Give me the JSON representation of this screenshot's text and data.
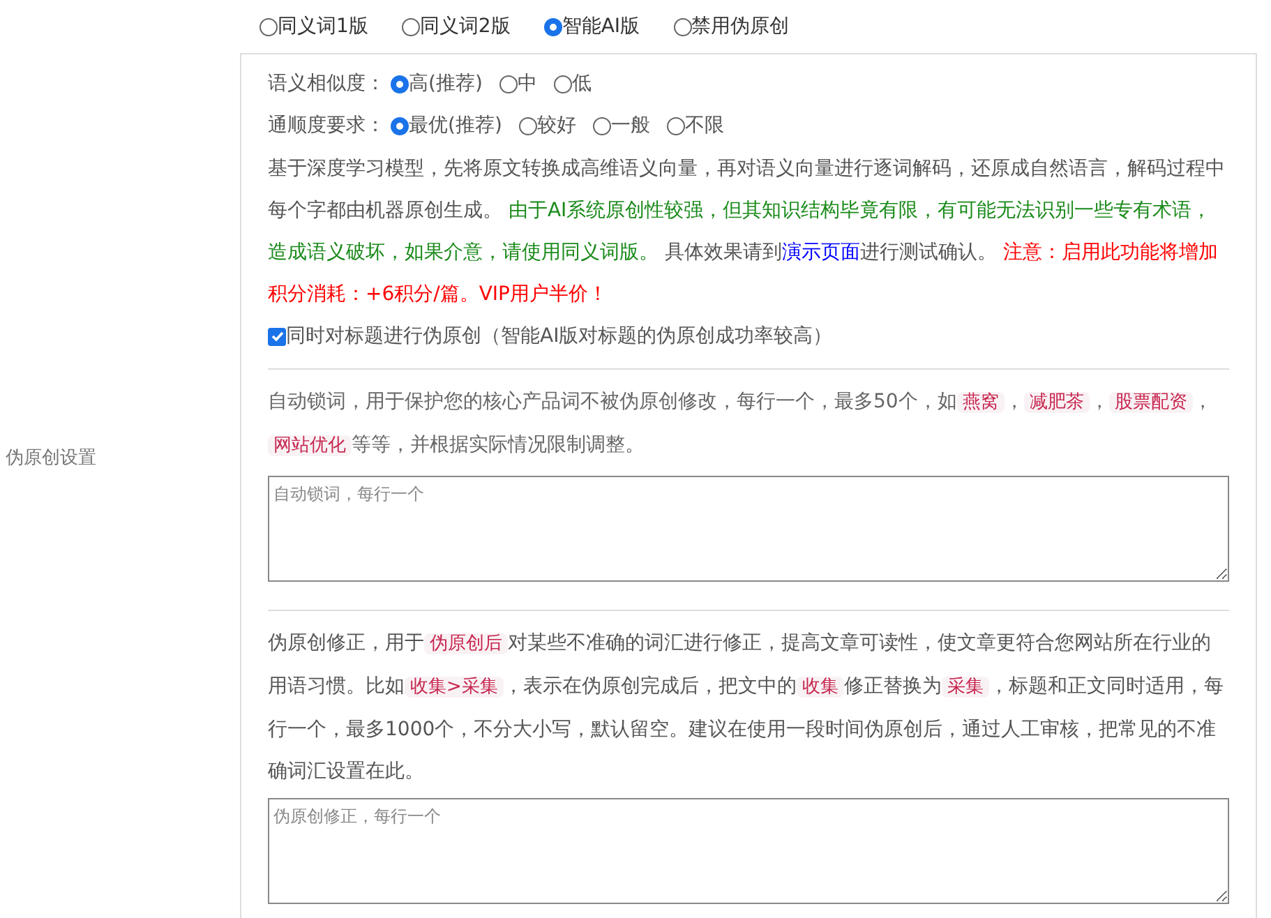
{
  "side_label": "伪原创设置",
  "modes": [
    {
      "label": "同义词1版",
      "selected": false
    },
    {
      "label": "同义词2版",
      "selected": false
    },
    {
      "label": "智能AI版",
      "selected": true
    },
    {
      "label": "禁用伪原创",
      "selected": false
    }
  ],
  "option_groups": [
    {
      "label": "语义相似度：",
      "options": [
        {
          "label": "高(推荐)",
          "selected": true
        },
        {
          "label": "中",
          "selected": false
        },
        {
          "label": "低",
          "selected": false
        }
      ]
    },
    {
      "label": "通顺度要求：",
      "options": [
        {
          "label": "最优(推荐)",
          "selected": true
        },
        {
          "label": "较好",
          "selected": false
        },
        {
          "label": "一般",
          "selected": false
        },
        {
          "label": "不限",
          "selected": false
        }
      ]
    }
  ],
  "ai_description": [
    {
      "kind": "plain",
      "text": "基于深度学习模型，先将原文转换成高维语义向量，再对语义向量进行逐词解码，还原成自然语言，解码过程中每个字都由机器原创生成。 "
    },
    {
      "kind": "green",
      "text": "由于AI系统原创性较强，但其知识结构毕竟有限，有可能无法识别一些专有术语，造成语义破坏，如果介意，请使用同义词版。"
    },
    {
      "kind": "plain",
      "text": " 具体效果请到"
    },
    {
      "kind": "link",
      "text": "演示页面"
    },
    {
      "kind": "plain",
      "text": "进行测试确认。 "
    },
    {
      "kind": "red",
      "text": "注意：启用此功能将增加积分消耗：+6积分/篇。VIP用户半价！"
    }
  ],
  "title_checkbox": {
    "label": "同时对标题进行伪原创（智能AI版对标题的伪原创成功率较高）",
    "checked": true
  },
  "lock_description": [
    {
      "kind": "plain",
      "text": "自动锁词，用于保护您的核心产品词不被伪原创修改，每行一个，最多50个，如"
    },
    {
      "kind": "code",
      "text": "燕窝"
    },
    {
      "kind": "plain",
      "text": "，"
    },
    {
      "kind": "code",
      "text": "减肥茶"
    },
    {
      "kind": "plain",
      "text": "，"
    },
    {
      "kind": "code",
      "text": "股票配资"
    },
    {
      "kind": "plain",
      "text": "，"
    },
    {
      "kind": "code",
      "text": "网站优化"
    },
    {
      "kind": "plain",
      "text": "等等，并根据实际情况限制调整。"
    }
  ],
  "lock_field": {
    "placeholder": "自动锁词，每行一个"
  },
  "fix_description": [
    {
      "kind": "plain",
      "text": "伪原创修正，用于"
    },
    {
      "kind": "code",
      "text": "伪原创后"
    },
    {
      "kind": "plain",
      "text": "对某些不准确的词汇进行修正，提高文章可读性，使文章更符合您网站所在行业的用语习惯。比如"
    },
    {
      "kind": "code",
      "text": "收集>采集"
    },
    {
      "kind": "plain",
      "text": "，表示在伪原创完成后，把文中的"
    },
    {
      "kind": "code",
      "text": "收集"
    },
    {
      "kind": "plain",
      "text": "修正替换为"
    },
    {
      "kind": "code",
      "text": "采集"
    },
    {
      "kind": "plain",
      "text": "，标题和正文同时适用，每行一个，最多1000个，不分大小写，默认留空。建议在使用一段时间伪原创后，通过人工审核，把常见的不准确词汇设置在此。"
    }
  ],
  "fix_field": {
    "placeholder": "伪原创修正，每行一个"
  }
}
